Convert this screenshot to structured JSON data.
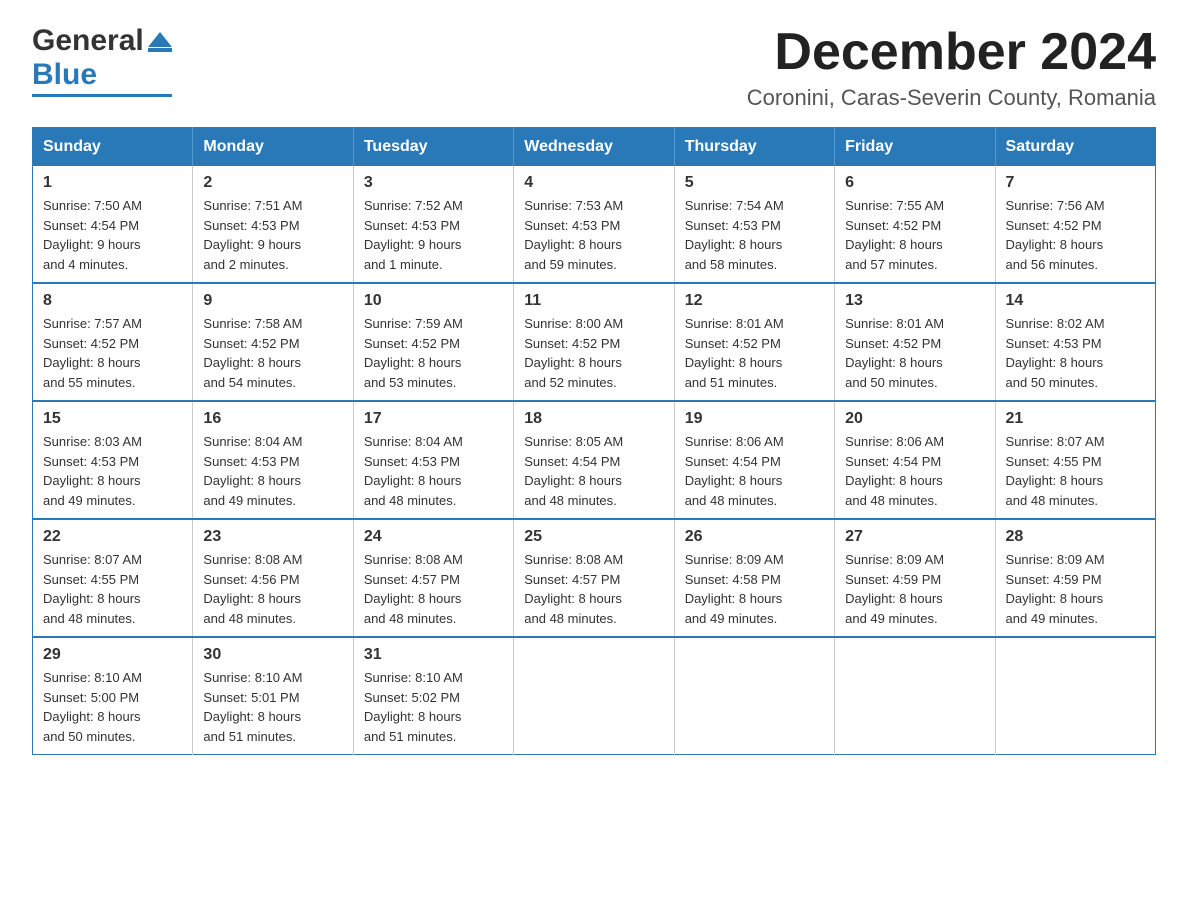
{
  "logo": {
    "general": "General",
    "blue": "Blue"
  },
  "header": {
    "month": "December 2024",
    "location": "Coronini, Caras-Severin County, Romania"
  },
  "weekdays": [
    "Sunday",
    "Monday",
    "Tuesday",
    "Wednesday",
    "Thursday",
    "Friday",
    "Saturday"
  ],
  "weeks": [
    [
      {
        "day": "1",
        "sunrise": "Sunrise: 7:50 AM",
        "sunset": "Sunset: 4:54 PM",
        "daylight": "Daylight: 9 hours",
        "daylight2": "and 4 minutes."
      },
      {
        "day": "2",
        "sunrise": "Sunrise: 7:51 AM",
        "sunset": "Sunset: 4:53 PM",
        "daylight": "Daylight: 9 hours",
        "daylight2": "and 2 minutes."
      },
      {
        "day": "3",
        "sunrise": "Sunrise: 7:52 AM",
        "sunset": "Sunset: 4:53 PM",
        "daylight": "Daylight: 9 hours",
        "daylight2": "and 1 minute."
      },
      {
        "day": "4",
        "sunrise": "Sunrise: 7:53 AM",
        "sunset": "Sunset: 4:53 PM",
        "daylight": "Daylight: 8 hours",
        "daylight2": "and 59 minutes."
      },
      {
        "day": "5",
        "sunrise": "Sunrise: 7:54 AM",
        "sunset": "Sunset: 4:53 PM",
        "daylight": "Daylight: 8 hours",
        "daylight2": "and 58 minutes."
      },
      {
        "day": "6",
        "sunrise": "Sunrise: 7:55 AM",
        "sunset": "Sunset: 4:52 PM",
        "daylight": "Daylight: 8 hours",
        "daylight2": "and 57 minutes."
      },
      {
        "day": "7",
        "sunrise": "Sunrise: 7:56 AM",
        "sunset": "Sunset: 4:52 PM",
        "daylight": "Daylight: 8 hours",
        "daylight2": "and 56 minutes."
      }
    ],
    [
      {
        "day": "8",
        "sunrise": "Sunrise: 7:57 AM",
        "sunset": "Sunset: 4:52 PM",
        "daylight": "Daylight: 8 hours",
        "daylight2": "and 55 minutes."
      },
      {
        "day": "9",
        "sunrise": "Sunrise: 7:58 AM",
        "sunset": "Sunset: 4:52 PM",
        "daylight": "Daylight: 8 hours",
        "daylight2": "and 54 minutes."
      },
      {
        "day": "10",
        "sunrise": "Sunrise: 7:59 AM",
        "sunset": "Sunset: 4:52 PM",
        "daylight": "Daylight: 8 hours",
        "daylight2": "and 53 minutes."
      },
      {
        "day": "11",
        "sunrise": "Sunrise: 8:00 AM",
        "sunset": "Sunset: 4:52 PM",
        "daylight": "Daylight: 8 hours",
        "daylight2": "and 52 minutes."
      },
      {
        "day": "12",
        "sunrise": "Sunrise: 8:01 AM",
        "sunset": "Sunset: 4:52 PM",
        "daylight": "Daylight: 8 hours",
        "daylight2": "and 51 minutes."
      },
      {
        "day": "13",
        "sunrise": "Sunrise: 8:01 AM",
        "sunset": "Sunset: 4:52 PM",
        "daylight": "Daylight: 8 hours",
        "daylight2": "and 50 minutes."
      },
      {
        "day": "14",
        "sunrise": "Sunrise: 8:02 AM",
        "sunset": "Sunset: 4:53 PM",
        "daylight": "Daylight: 8 hours",
        "daylight2": "and 50 minutes."
      }
    ],
    [
      {
        "day": "15",
        "sunrise": "Sunrise: 8:03 AM",
        "sunset": "Sunset: 4:53 PM",
        "daylight": "Daylight: 8 hours",
        "daylight2": "and 49 minutes."
      },
      {
        "day": "16",
        "sunrise": "Sunrise: 8:04 AM",
        "sunset": "Sunset: 4:53 PM",
        "daylight": "Daylight: 8 hours",
        "daylight2": "and 49 minutes."
      },
      {
        "day": "17",
        "sunrise": "Sunrise: 8:04 AM",
        "sunset": "Sunset: 4:53 PM",
        "daylight": "Daylight: 8 hours",
        "daylight2": "and 48 minutes."
      },
      {
        "day": "18",
        "sunrise": "Sunrise: 8:05 AM",
        "sunset": "Sunset: 4:54 PM",
        "daylight": "Daylight: 8 hours",
        "daylight2": "and 48 minutes."
      },
      {
        "day": "19",
        "sunrise": "Sunrise: 8:06 AM",
        "sunset": "Sunset: 4:54 PM",
        "daylight": "Daylight: 8 hours",
        "daylight2": "and 48 minutes."
      },
      {
        "day": "20",
        "sunrise": "Sunrise: 8:06 AM",
        "sunset": "Sunset: 4:54 PM",
        "daylight": "Daylight: 8 hours",
        "daylight2": "and 48 minutes."
      },
      {
        "day": "21",
        "sunrise": "Sunrise: 8:07 AM",
        "sunset": "Sunset: 4:55 PM",
        "daylight": "Daylight: 8 hours",
        "daylight2": "and 48 minutes."
      }
    ],
    [
      {
        "day": "22",
        "sunrise": "Sunrise: 8:07 AM",
        "sunset": "Sunset: 4:55 PM",
        "daylight": "Daylight: 8 hours",
        "daylight2": "and 48 minutes."
      },
      {
        "day": "23",
        "sunrise": "Sunrise: 8:08 AM",
        "sunset": "Sunset: 4:56 PM",
        "daylight": "Daylight: 8 hours",
        "daylight2": "and 48 minutes."
      },
      {
        "day": "24",
        "sunrise": "Sunrise: 8:08 AM",
        "sunset": "Sunset: 4:57 PM",
        "daylight": "Daylight: 8 hours",
        "daylight2": "and 48 minutes."
      },
      {
        "day": "25",
        "sunrise": "Sunrise: 8:08 AM",
        "sunset": "Sunset: 4:57 PM",
        "daylight": "Daylight: 8 hours",
        "daylight2": "and 48 minutes."
      },
      {
        "day": "26",
        "sunrise": "Sunrise: 8:09 AM",
        "sunset": "Sunset: 4:58 PM",
        "daylight": "Daylight: 8 hours",
        "daylight2": "and 49 minutes."
      },
      {
        "day": "27",
        "sunrise": "Sunrise: 8:09 AM",
        "sunset": "Sunset: 4:59 PM",
        "daylight": "Daylight: 8 hours",
        "daylight2": "and 49 minutes."
      },
      {
        "day": "28",
        "sunrise": "Sunrise: 8:09 AM",
        "sunset": "Sunset: 4:59 PM",
        "daylight": "Daylight: 8 hours",
        "daylight2": "and 49 minutes."
      }
    ],
    [
      {
        "day": "29",
        "sunrise": "Sunrise: 8:10 AM",
        "sunset": "Sunset: 5:00 PM",
        "daylight": "Daylight: 8 hours",
        "daylight2": "and 50 minutes."
      },
      {
        "day": "30",
        "sunrise": "Sunrise: 8:10 AM",
        "sunset": "Sunset: 5:01 PM",
        "daylight": "Daylight: 8 hours",
        "daylight2": "and 51 minutes."
      },
      {
        "day": "31",
        "sunrise": "Sunrise: 8:10 AM",
        "sunset": "Sunset: 5:02 PM",
        "daylight": "Daylight: 8 hours",
        "daylight2": "and 51 minutes."
      },
      null,
      null,
      null,
      null
    ]
  ]
}
